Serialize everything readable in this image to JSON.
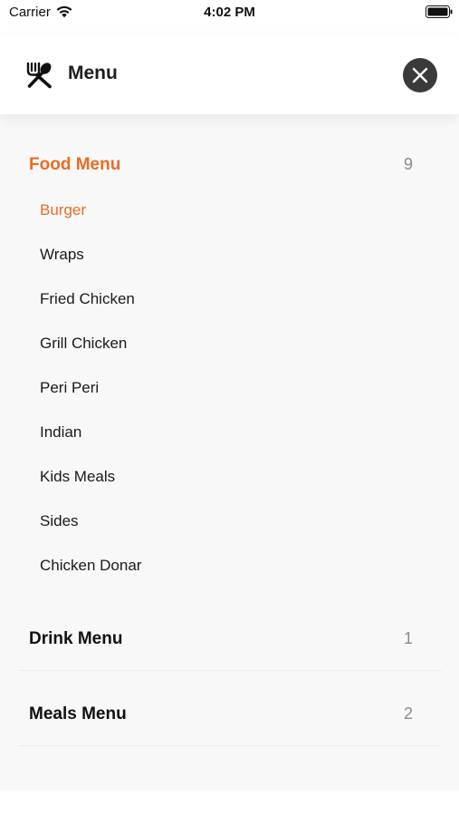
{
  "status_bar": {
    "carrier": "Carrier",
    "time": "4:02 PM",
    "icons": [
      "wifi-icon",
      "battery-icon"
    ]
  },
  "header": {
    "title": "Menu",
    "icon": "fork-spoon-icon",
    "close_icon": "close-icon"
  },
  "colors": {
    "accent": "#ee6a22",
    "close_button_bg": "#3a3a3a",
    "panel_bg": "#f8f8f8",
    "count_text": "#8a8a8a"
  },
  "sections": [
    {
      "title": "Food Menu",
      "count": "9",
      "active": true,
      "items": [
        {
          "label": "Burger",
          "active": true
        },
        {
          "label": "Wraps"
        },
        {
          "label": "Fried Chicken"
        },
        {
          "label": "Grill Chicken"
        },
        {
          "label": "Peri Peri"
        },
        {
          "label": "Indian"
        },
        {
          "label": "Kids Meals"
        },
        {
          "label": "Sides"
        },
        {
          "label": "Chicken Donar"
        }
      ]
    },
    {
      "title": "Drink Menu",
      "count": "1"
    },
    {
      "title": "Meals Menu",
      "count": "2"
    }
  ]
}
